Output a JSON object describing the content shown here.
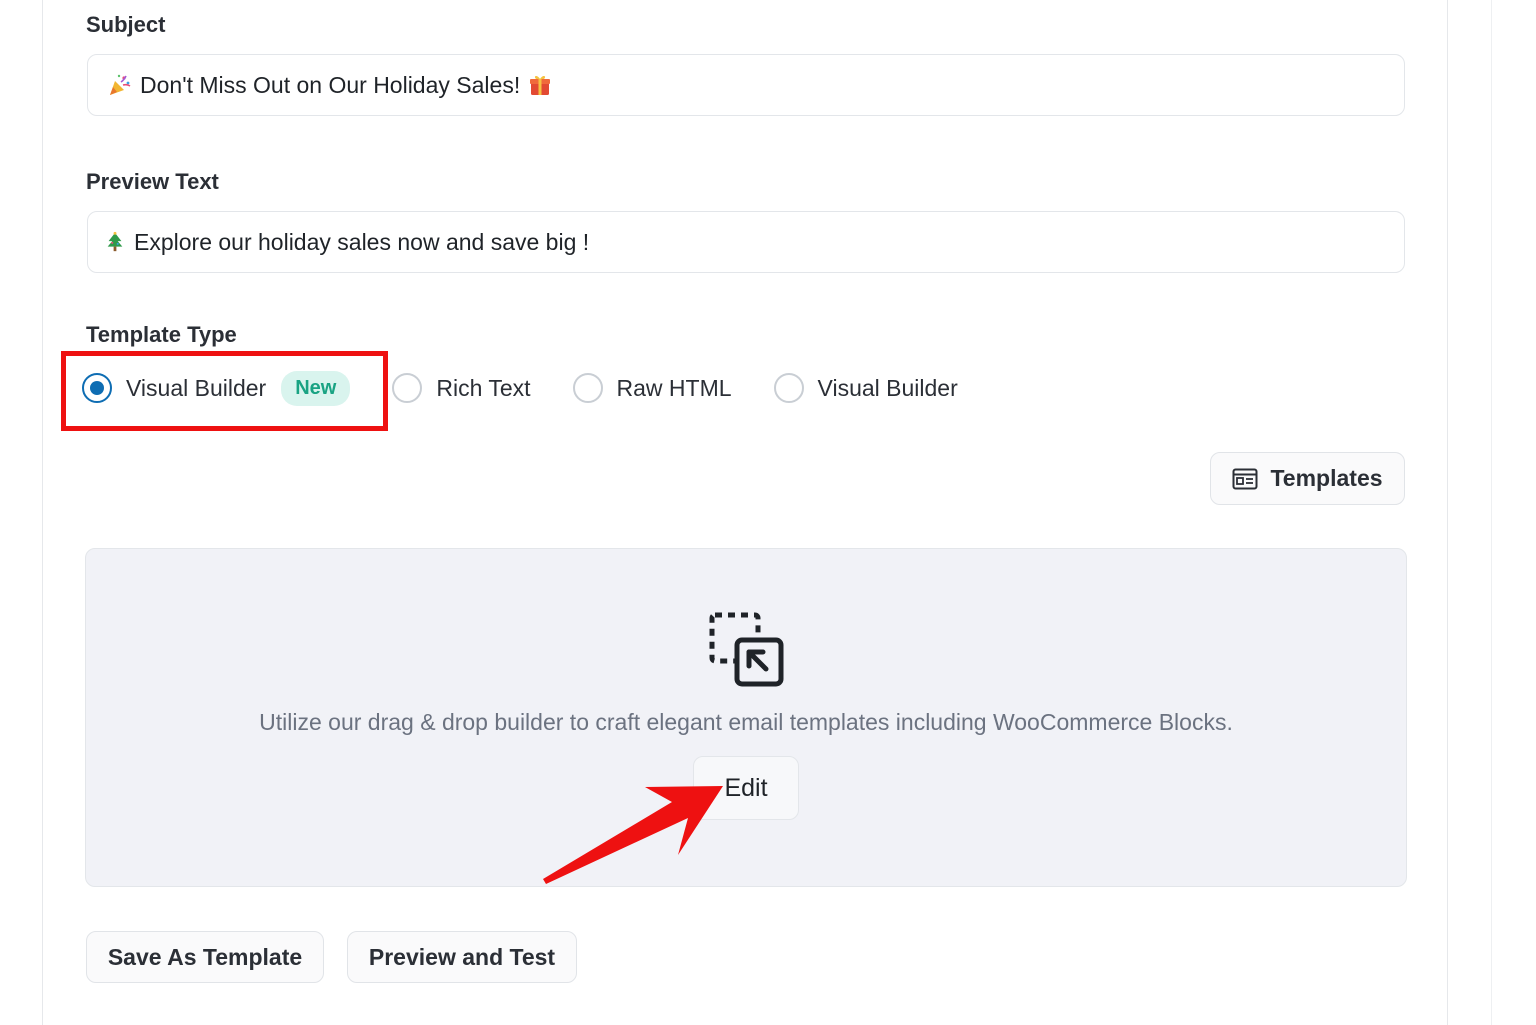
{
  "subject": {
    "label": "Subject",
    "value": "Don't Miss Out on Our Holiday Sales!",
    "lead_icon": "party-popper-icon",
    "trail_icon": "gift-icon"
  },
  "preview_text": {
    "label": "Preview Text",
    "value": "Explore our holiday sales now and save big !",
    "lead_icon": "christmas-tree-icon"
  },
  "template_type": {
    "label": "Template Type",
    "options": [
      {
        "label": "Visual Builder",
        "badge": "New",
        "checked": true
      },
      {
        "label": "Rich Text",
        "checked": false
      },
      {
        "label": "Raw HTML",
        "checked": false
      },
      {
        "label": "Visual Builder",
        "checked": false
      }
    ]
  },
  "templates_button": {
    "label": "Templates",
    "icon": "template-icon"
  },
  "builder": {
    "icon": "drag-drop-icon",
    "description": "Utilize our drag & drop builder to craft elegant email templates including WooCommerce Blocks.",
    "edit_label": "Edit"
  },
  "footer": {
    "save_template_label": "Save As Template",
    "preview_test_label": "Preview and Test"
  },
  "colors": {
    "accent": "#0e6db3",
    "badge_bg": "#d9f4ee",
    "badge_text": "#19a383",
    "annotation": "#ee1111"
  }
}
